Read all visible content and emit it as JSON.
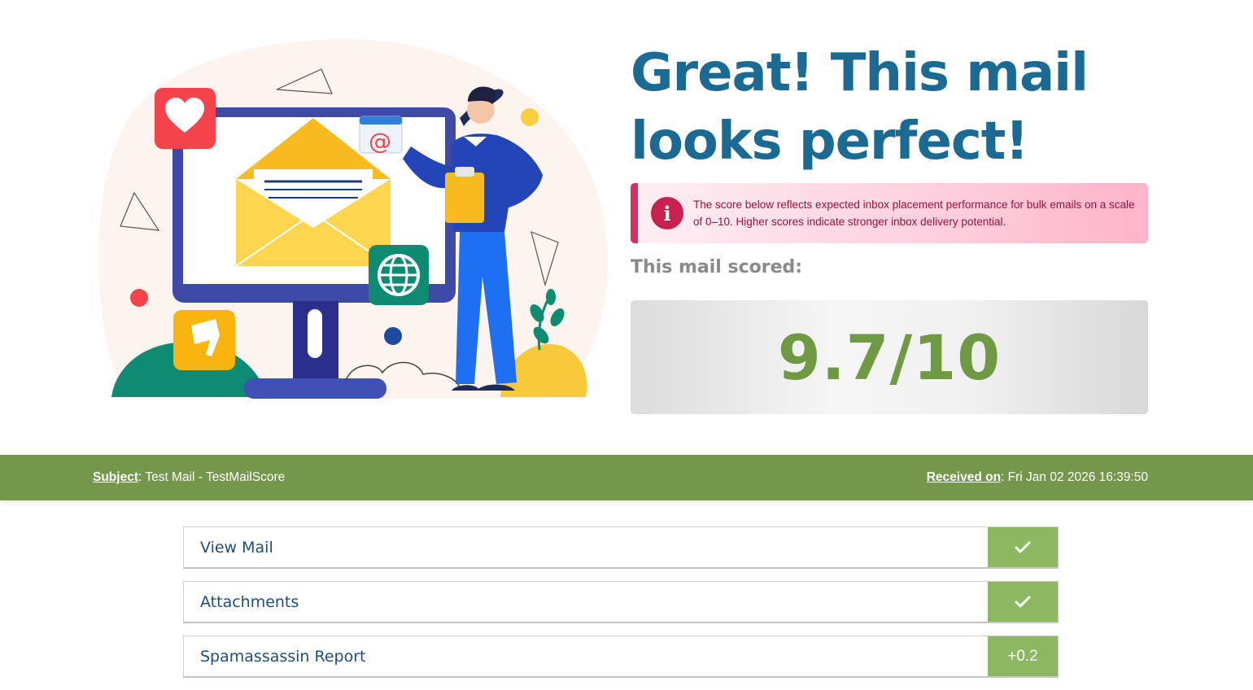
{
  "hero": {
    "headline": "Great! This mail looks perfect!",
    "info_icon": "info-icon",
    "info_text": "The score below reflects expected inbox placement performance for bulk emails on a scale of 0–10. Higher scores indicate stronger inbox delivery potential.",
    "scored_label": "This mail scored:",
    "score": "9.7/10"
  },
  "meta": {
    "subject_key": "Subject",
    "subject_value": ": Test Mail - TestMailScore",
    "received_key": "Received on",
    "received_value": ": Fri Jan 02 2026 16:39:50"
  },
  "sections": [
    {
      "label": "View Mail",
      "status_icon": "check-icon"
    },
    {
      "label": "Attachments",
      "status_icon": "check-icon"
    },
    {
      "label": "Spamassassin Report",
      "status": "+0.2"
    }
  ],
  "colors": {
    "headline": "#1b6a93",
    "score": "#6f9a43",
    "meta_bar": "#74974c",
    "status_bg": "#8db861",
    "info_accent": "#dc2e63"
  }
}
